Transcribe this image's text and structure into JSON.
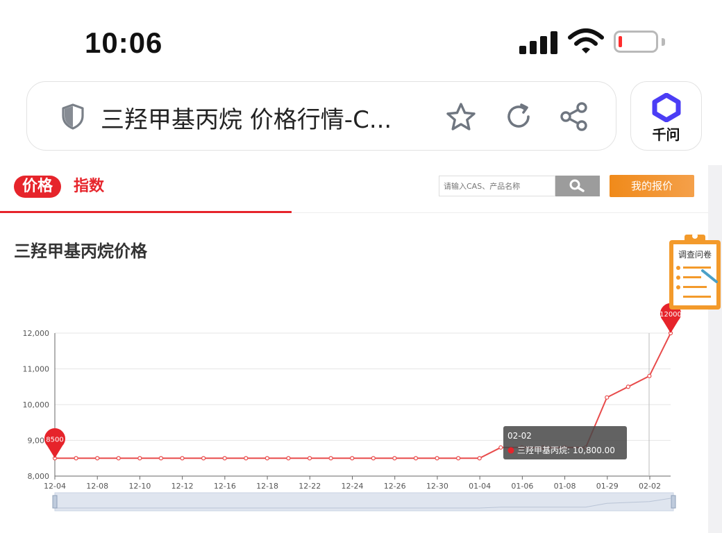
{
  "status_bar": {
    "time": "10:06"
  },
  "browser": {
    "page_title": "三羟甲基丙烷 价格行情-C...",
    "assistant_label": "千问"
  },
  "page": {
    "tabs": [
      {
        "label": "价格"
      },
      {
        "label": "指数"
      }
    ],
    "search": {
      "placeholder": "请输入CAS、产品名称"
    },
    "quote_button": "我的报价",
    "chart_title": "三羟甲基丙烷价格",
    "survey_label": "调查问卷"
  },
  "colors": {
    "accent": "#e6242b",
    "orange": "#f08a1a",
    "line": "#e84b4b"
  },
  "chart_data": {
    "type": "line",
    "series": [
      {
        "name": "三羟甲基丙烷",
        "values": [
          8500,
          8500,
          8500,
          8500,
          8500,
          8500,
          8500,
          8500,
          8500,
          8500,
          8500,
          8500,
          8500,
          8500,
          8500,
          8500,
          8500,
          8500,
          8500,
          8500,
          8500,
          8800,
          8800,
          8800,
          8800,
          8800,
          10200,
          10500,
          10800,
          12000
        ]
      }
    ],
    "x_tick_labels": [
      "12-04",
      "12-08",
      "12-10",
      "12-12",
      "12-16",
      "12-18",
      "12-22",
      "12-24",
      "12-26",
      "12-30",
      "01-04",
      "01-06",
      "01-08",
      "01-29",
      "02-02"
    ],
    "y_tick_labels": [
      "8,000",
      "9,000",
      "10,000",
      "11,000",
      "12,000"
    ],
    "ylim": [
      8000,
      12000
    ],
    "markers": [
      {
        "label": "8500",
        "index": 0
      },
      {
        "label": "12000",
        "index": 29
      }
    ],
    "tooltip": {
      "title": "02-02",
      "series": "三羟甲基丙烷",
      "value": "10,800.00",
      "index": 28
    },
    "grid": true,
    "data_zoom": true
  }
}
